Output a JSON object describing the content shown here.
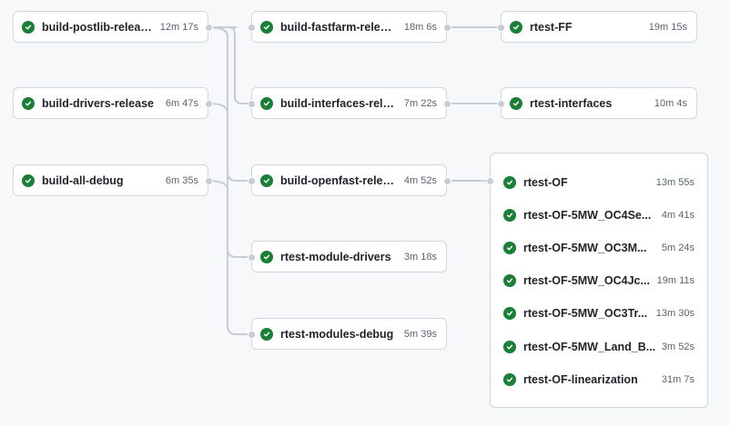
{
  "status_color": "#1a7f37",
  "status_icon": "check-circle-icon",
  "jobs": {
    "postlib": {
      "name": "build-postlib-release",
      "duration": "12m 17s"
    },
    "drivers": {
      "name": "build-drivers-release",
      "duration": "6m 47s"
    },
    "alldebug": {
      "name": "build-all-debug",
      "duration": "6m 35s"
    },
    "fastfarm": {
      "name": "build-fastfarm-release",
      "duration": "18m 6s"
    },
    "interfaces": {
      "name": "build-interfaces-release",
      "duration": "7m 22s"
    },
    "openfast": {
      "name": "build-openfast-release",
      "duration": "4m 52s"
    },
    "moddrivers": {
      "name": "rtest-module-drivers",
      "duration": "3m 18s"
    },
    "moddebug": {
      "name": "rtest-modules-debug",
      "duration": "5m 39s"
    },
    "rtestff": {
      "name": "rtest-FF",
      "duration": "19m 15s"
    },
    "rtestinterfaces": {
      "name": "rtest-interfaces",
      "duration": "10m 4s"
    }
  },
  "matrix": [
    {
      "name": "rtest-OF",
      "duration": "13m 55s"
    },
    {
      "name": "rtest-OF-5MW_OC4Se...",
      "duration": "4m 41s"
    },
    {
      "name": "rtest-OF-5MW_OC3M...",
      "duration": "5m 24s"
    },
    {
      "name": "rtest-OF-5MW_OC4Jc...",
      "duration": "19m 11s"
    },
    {
      "name": "rtest-OF-5MW_OC3Tr...",
      "duration": "13m 30s"
    },
    {
      "name": "rtest-OF-5MW_Land_B...",
      "duration": "3m 52s"
    },
    {
      "name": "rtest-OF-linearization",
      "duration": "31m 7s"
    }
  ]
}
